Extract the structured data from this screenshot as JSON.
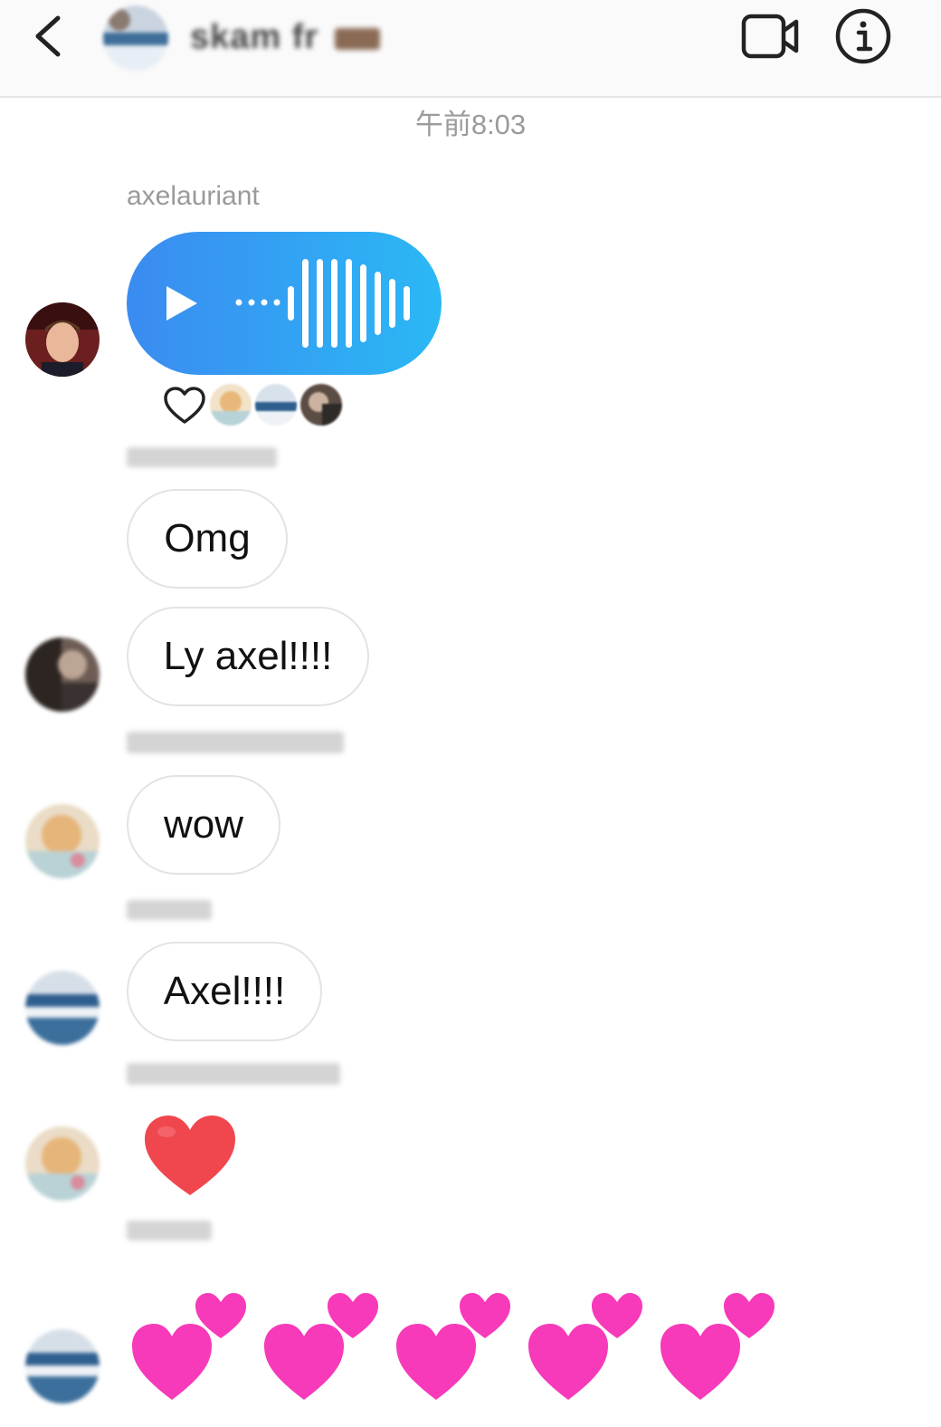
{
  "header": {
    "group_title": "skam fr",
    "icons": {
      "back": "back-chevron-icon",
      "video": "video-camera-icon",
      "info": "info-icon"
    }
  },
  "timestamp": "午前8:03",
  "colors": {
    "voice_gradient_start": "#3b8bf0",
    "voice_gradient_end": "#2bb8f5",
    "heart_red": "#f0474f",
    "heart_pink": "#f73ab9",
    "bubble_border": "#e3e3e3",
    "meta_text": "#9a9a9a"
  },
  "messages": [
    {
      "sender": "axelauriant",
      "type": "voice",
      "reactions": {
        "icon": "heart-outline-icon",
        "reactors": 3
      }
    },
    {
      "sender": "",
      "type": "text",
      "texts": [
        "Omg",
        "Ly axel!!!!"
      ]
    },
    {
      "sender": "",
      "type": "text",
      "texts": [
        "wow"
      ]
    },
    {
      "sender": "",
      "type": "text",
      "texts": [
        "Axel!!!!"
      ]
    },
    {
      "sender": "",
      "type": "emoji",
      "emoji": "❤️"
    },
    {
      "sender": "",
      "type": "emoji",
      "emoji": "💕💕💕💕💕"
    }
  ]
}
